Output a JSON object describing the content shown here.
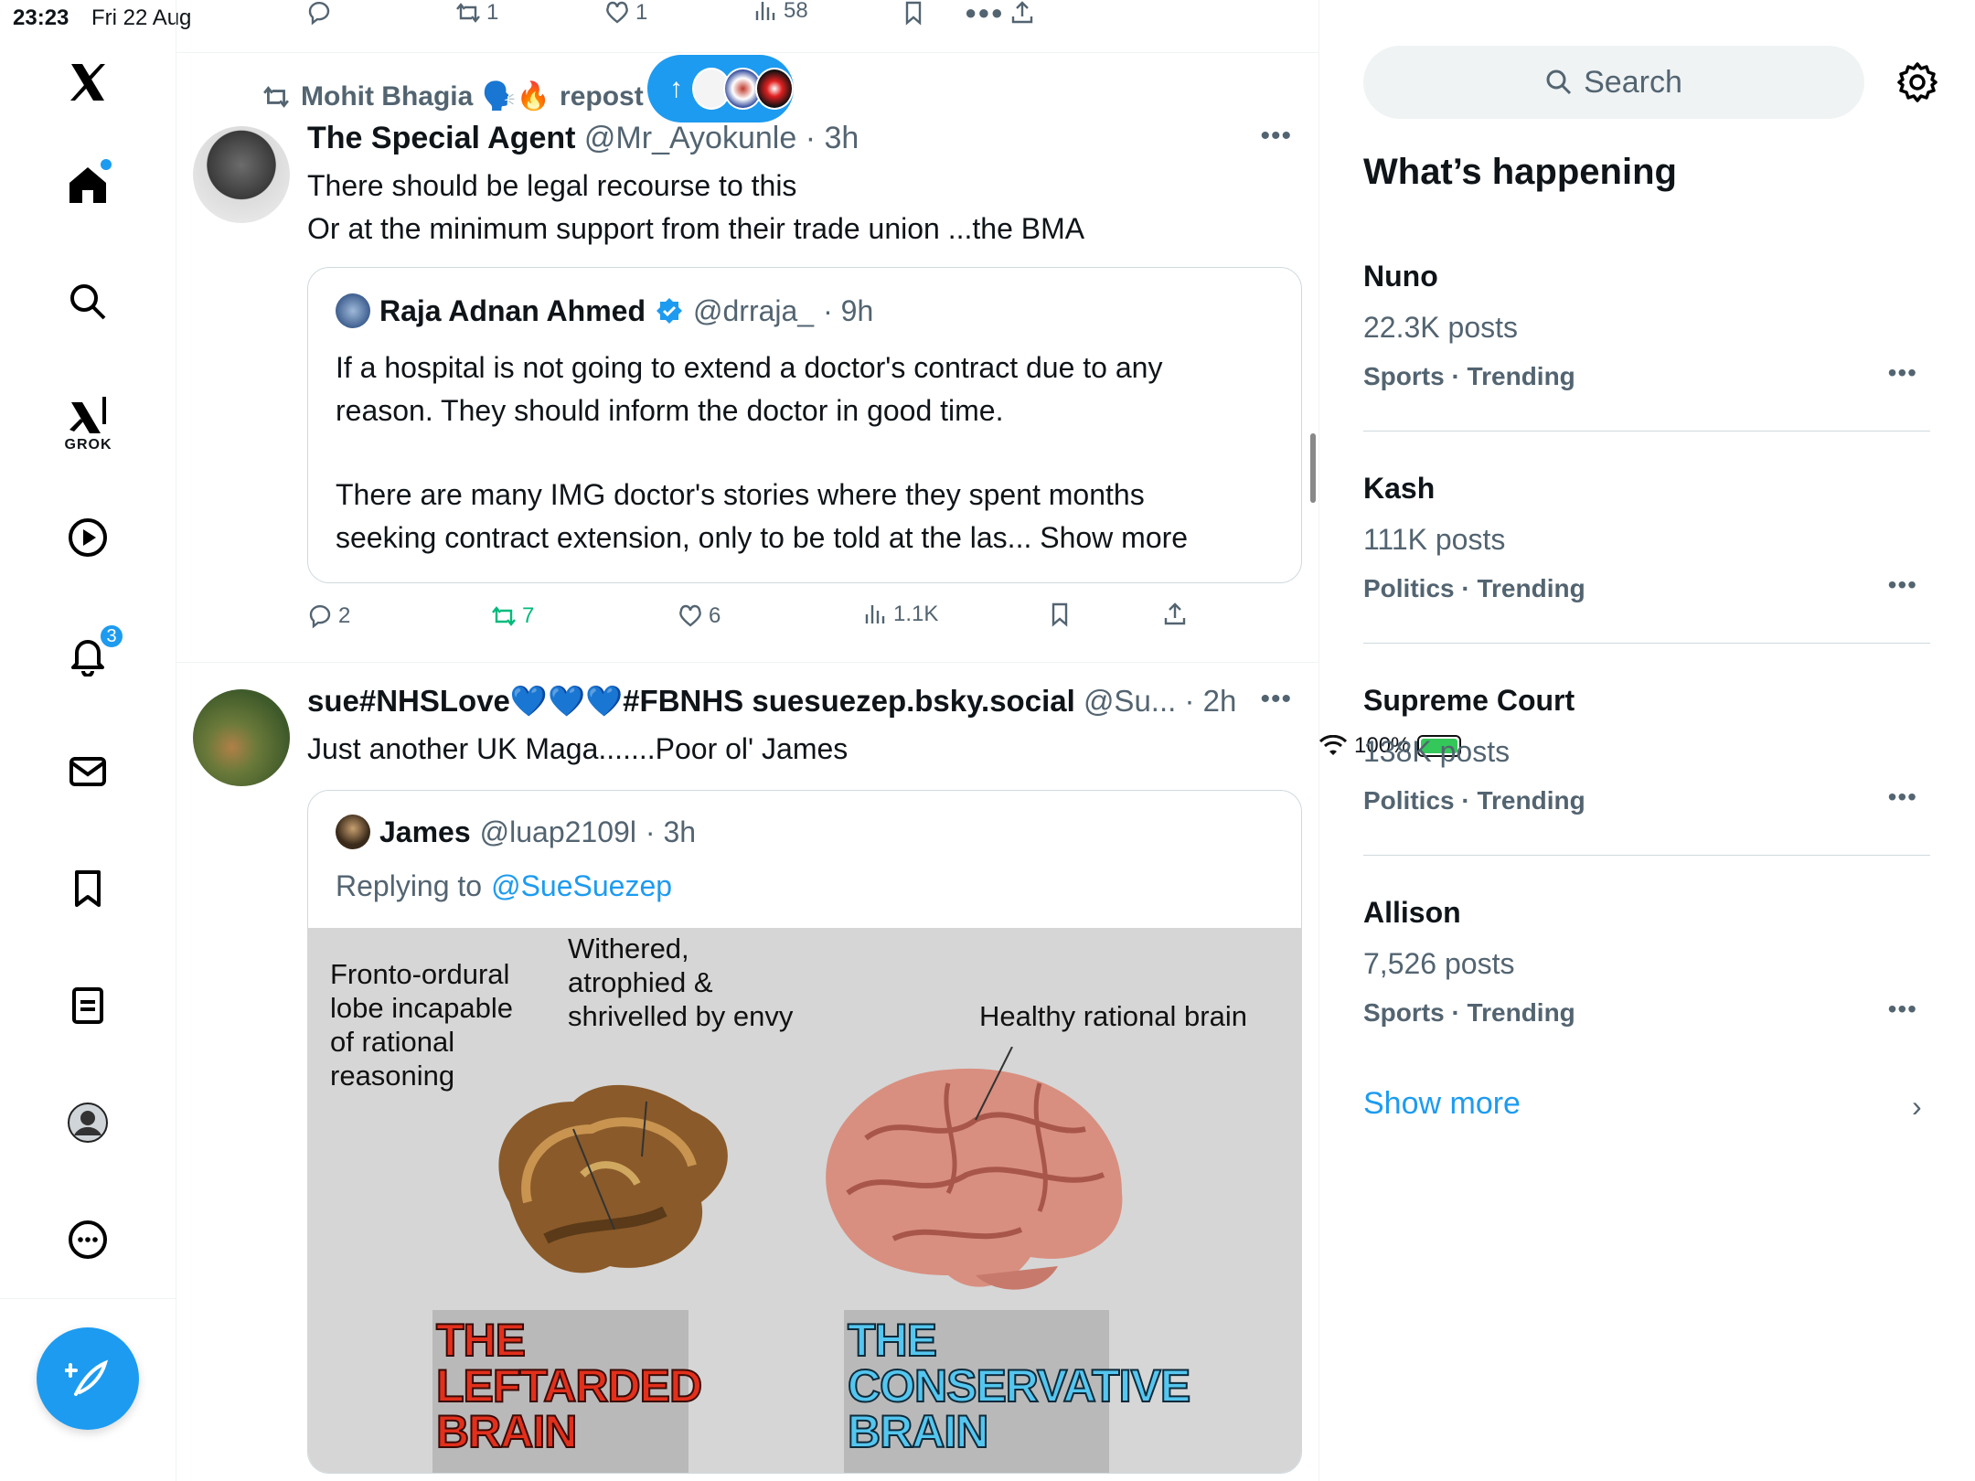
{
  "status_bar": {
    "time": "23:23",
    "date": "Fri 22 Aug",
    "battery": "100%"
  },
  "nav": {
    "notifications_badge": "3",
    "grok_label": "GROK"
  },
  "feed": {
    "previous_tweet": {
      "retweets": "1",
      "likes": "1",
      "views": "58"
    },
    "tweet1": {
      "repost_by": "Mohit Bhagia",
      "repost_emoji": "🗣️🔥",
      "repost_word": "repost",
      "author_name": "The Special Agent",
      "author_handle": "@Mr_Ayokunle",
      "time": "· 3h",
      "text_line1": "There should be legal recourse to this",
      "text_line2": "Or at the minimum support from their trade union ...the BMA",
      "quote": {
        "author_name": "Raja Adnan Ahmed",
        "author_handle": "@drraja_",
        "time": "· 9h",
        "line1": "If a hospital is not going to extend a doctor's contract due to any",
        "line2": "reason. They should inform the doctor in good time.",
        "line3": "There are many IMG doctor's stories where they spent months",
        "line4": "seeking contract extension, only to be told at the las... Show more"
      },
      "replies": "2",
      "retweets": "7",
      "likes": "6",
      "views": "1.1K"
    },
    "tweet2": {
      "author_name": "sue#NHSLove💙💙💙#FBNHS suesuezep.bsky.social",
      "author_handle": "@Su...",
      "time": "· 2h",
      "text": "Just another UK Maga.......Poor ol' James",
      "quote": {
        "author_name": "James",
        "author_handle": "@luap2109l",
        "time": "· 3h",
        "replying_prefix": "Replying to",
        "replying_to": "@SueSuezep",
        "image": {
          "label_left": "Fronto-ordural\nlobe incapable\nof rational\nreasoning",
          "label_mid": "Withered,\natrophied &\nshrivelled by envy",
          "label_right": "Healthy rational brain",
          "caption_left": "THE\nLEFTARDED\nBRAIN",
          "caption_right": "THE\nCONSERVATIVE\nBRAIN"
        }
      }
    }
  },
  "right": {
    "search_placeholder": "Search",
    "section_title": "What’s happening",
    "trends": [
      {
        "name": "Nuno",
        "count": "22.3K posts",
        "category": "Sports · Trending"
      },
      {
        "name": "Kash",
        "count": "111K posts",
        "category": "Politics · Trending"
      },
      {
        "name": "Supreme Court",
        "count": "138K posts",
        "category": "Politics · Trending"
      },
      {
        "name": "Allison",
        "count": "7,526 posts",
        "category": "Sports · Trending"
      }
    ],
    "show_more": "Show more"
  },
  "colors": {
    "accent": "#1d9bf0",
    "muted": "#536471",
    "repost_green": "#00ba7c"
  }
}
